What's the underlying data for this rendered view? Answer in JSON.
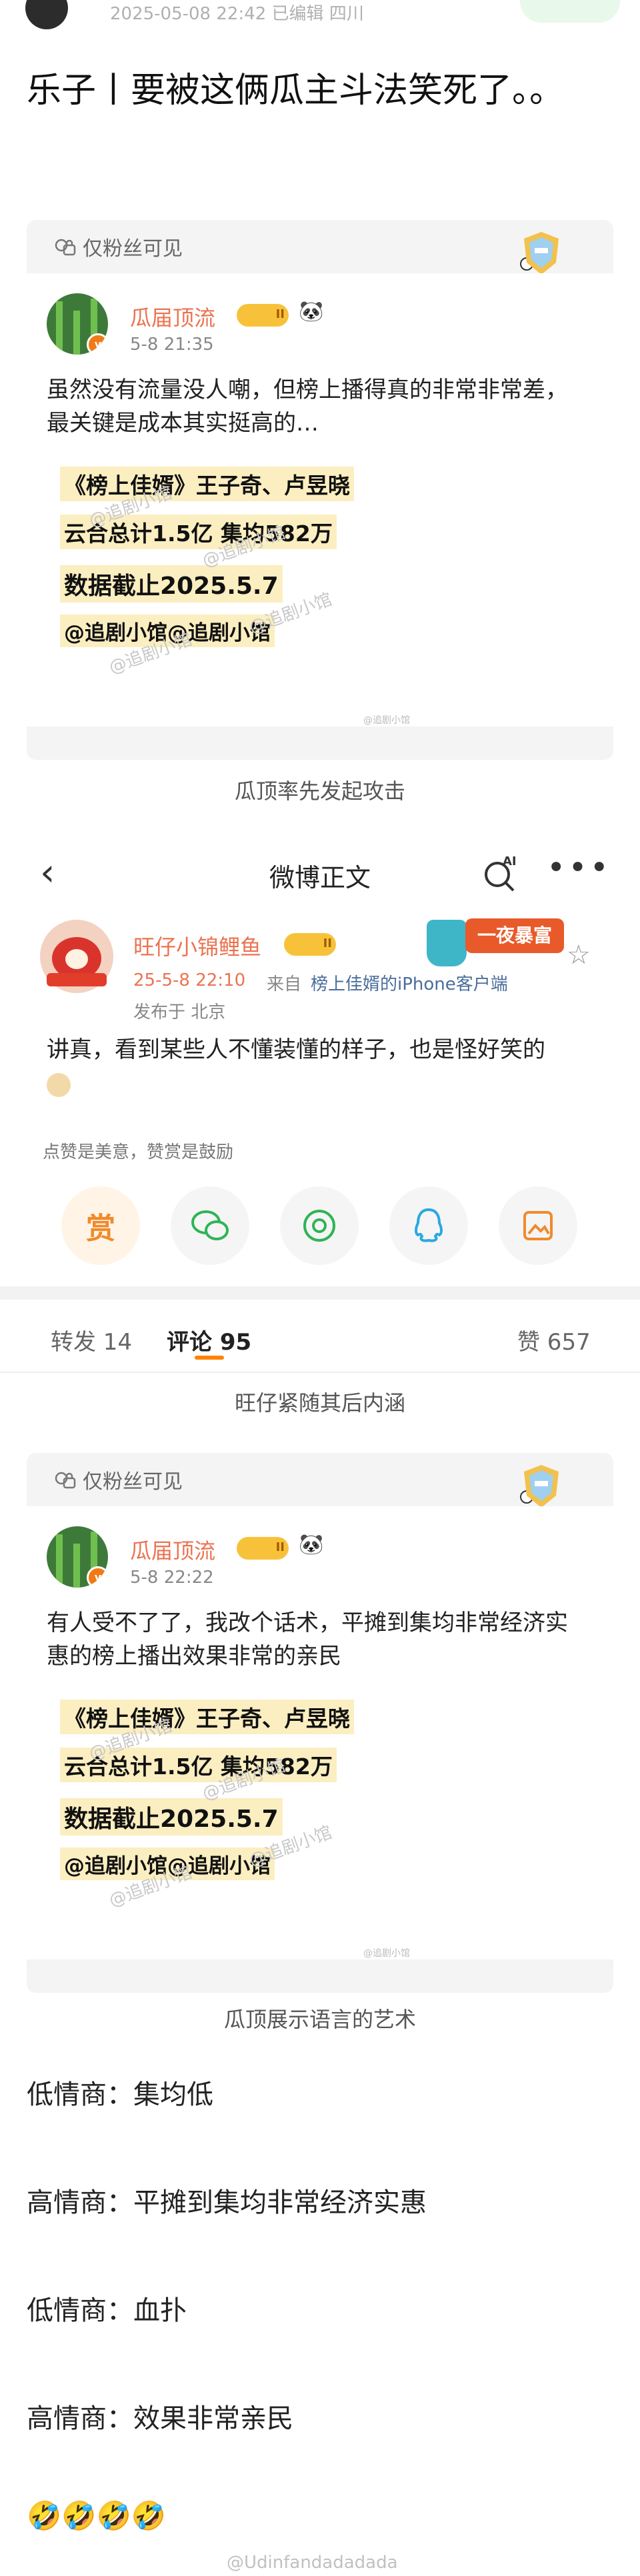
{
  "top": {
    "meta": "2025-05-08 22:42 已编辑 四川"
  },
  "headline": "乐子丨要被这俩瓜主斗法笑死了。。",
  "card1": {
    "fans_only": "仅粉丝可见",
    "username": "瓜届顶流",
    "level": "II",
    "time": "5-8 21:35",
    "text": "虽然没有流量没人嘲，但榜上播得真的非常非常差，最关键是成本其实挺高的…",
    "image_lines": [
      "《榜上佳婿》王子奇、卢昱晓",
      "云合总计1.5亿  集均582万",
      "数据截止2025.5.7",
      "@追剧小馆@追剧小馆"
    ],
    "watermark": "@追剧小馆",
    "tiny_wm": "@追剧小馆",
    "caption": "瓜顶率先发起攻击"
  },
  "post": {
    "nav_title": "微博正文",
    "ai_label": "AI",
    "username": "旺仔小锦鲤鱼",
    "level": "II",
    "badge": "一夜暴富",
    "time": "25-5-8 22:10",
    "source_prefix": "来自",
    "source": "榜上佳婿的iPhone客户端",
    "location": "发布于 北京",
    "text": "讲真，看到某些人不懂装懂的样子，也是怪好笑的",
    "reward_note": "点赞是美意，赞赏是鼓励",
    "reward_label": "赏",
    "tabs": {
      "repost": "转发 14",
      "comment": "评论 95",
      "like": "赞 657"
    },
    "caption": "旺仔紧随其后内涵"
  },
  "card2": {
    "fans_only": "仅粉丝可见",
    "username": "瓜届顶流",
    "level": "II",
    "time": "5-8 22:22",
    "text": "有人受不了了，我改个话术，平摊到集均非常经济实惠的榜上播出效果非常的亲民",
    "image_lines": [
      "《榜上佳婿》王子奇、卢昱晓",
      "云合总计1.5亿  集均582万",
      "数据截止2025.5.7",
      "@追剧小馆@追剧小馆"
    ],
    "watermark": "@追剧小馆",
    "tiny_wm": "@追剧小馆",
    "caption": "瓜顶展示语言的艺术"
  },
  "lines": [
    "低情商：集均低",
    "高情商：平摊到集均非常经济实惠",
    "低情商：血扑",
    "高情商：效果非常亲民"
  ],
  "emojis": "🤣🤣🤣🤣",
  "footer_wm": "@Udinfandadadada",
  "colors": {
    "accent": "#ff8200",
    "username": "#eb7350",
    "highlight": "#fbeec0"
  }
}
